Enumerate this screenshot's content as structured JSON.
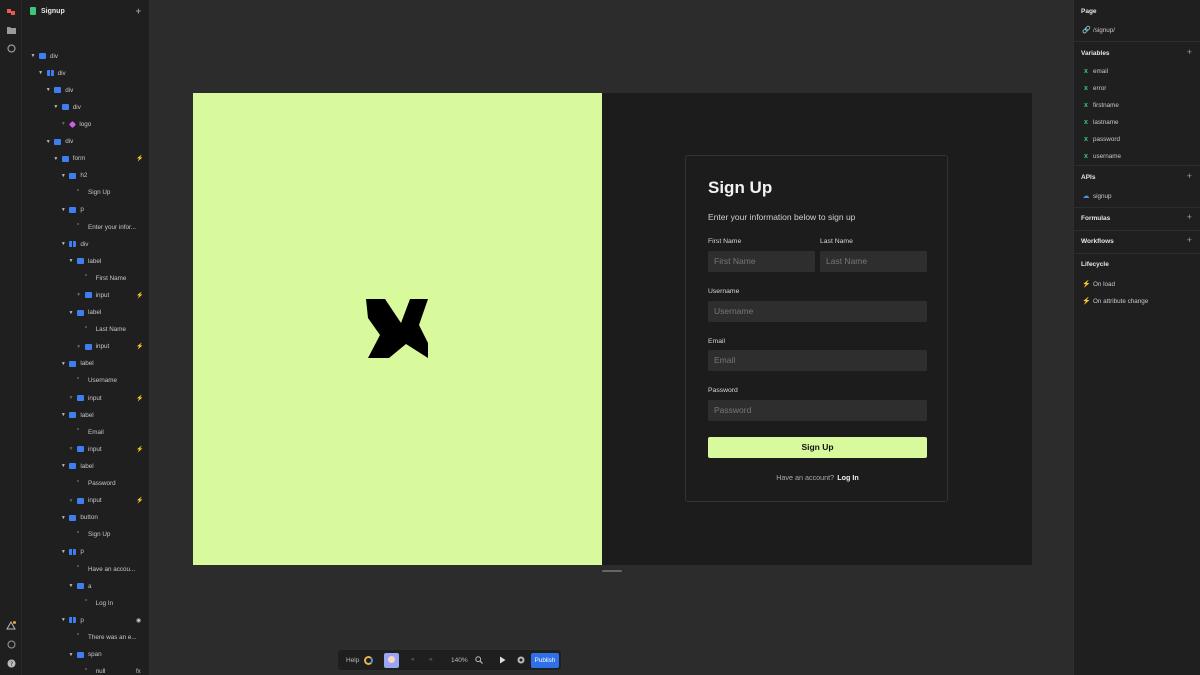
{
  "tree": {
    "title": "Signup",
    "nodes": [
      {
        "label": "div",
        "indent": 0,
        "icon": "block",
        "caret": true
      },
      {
        "label": "div",
        "indent": 1,
        "icon": "col",
        "caret": true
      },
      {
        "label": "div",
        "indent": 2,
        "icon": "block",
        "caret": true
      },
      {
        "label": "div",
        "indent": 3,
        "icon": "block",
        "caret": true
      },
      {
        "label": "logo",
        "indent": 4,
        "icon": "cmp",
        "caret": "dim"
      },
      {
        "label": "div",
        "indent": 2,
        "icon": "block",
        "caret": true
      },
      {
        "label": "form",
        "indent": 3,
        "icon": "block",
        "caret": true,
        "bolt": true
      },
      {
        "label": "h2",
        "indent": 4,
        "icon": "block",
        "caret": true
      },
      {
        "label": "Sign Up",
        "indent": 5,
        "icon": "quote"
      },
      {
        "label": "p",
        "indent": 4,
        "icon": "block",
        "caret": true
      },
      {
        "label": "Enter your infor...",
        "indent": 5,
        "icon": "quote"
      },
      {
        "label": "div",
        "indent": 4,
        "icon": "col",
        "caret": true
      },
      {
        "label": "label",
        "indent": 5,
        "icon": "block",
        "caret": true
      },
      {
        "label": "First Name",
        "indent": 6,
        "icon": "quote"
      },
      {
        "label": "input",
        "indent": 6,
        "icon": "block",
        "caret": "dim",
        "bolt": true
      },
      {
        "label": "label",
        "indent": 5,
        "icon": "block",
        "caret": true
      },
      {
        "label": "Last Name",
        "indent": 6,
        "icon": "quote"
      },
      {
        "label": "input",
        "indent": 6,
        "icon": "block",
        "caret": "dim",
        "bolt": true
      },
      {
        "label": "label",
        "indent": 4,
        "icon": "block",
        "caret": true
      },
      {
        "label": "Username",
        "indent": 5,
        "icon": "quote"
      },
      {
        "label": "input",
        "indent": 5,
        "icon": "block",
        "caret": "dim",
        "bolt": true
      },
      {
        "label": "label",
        "indent": 4,
        "icon": "block",
        "caret": true
      },
      {
        "label": "Email",
        "indent": 5,
        "icon": "quote"
      },
      {
        "label": "input",
        "indent": 5,
        "icon": "block",
        "caret": "dim",
        "bolt": true
      },
      {
        "label": "label",
        "indent": 4,
        "icon": "block",
        "caret": true
      },
      {
        "label": "Password",
        "indent": 5,
        "icon": "quote"
      },
      {
        "label": "input",
        "indent": 5,
        "icon": "block",
        "caret": "dim",
        "bolt": true
      },
      {
        "label": "button",
        "indent": 4,
        "icon": "block",
        "caret": true
      },
      {
        "label": "Sign Up",
        "indent": 5,
        "icon": "quote"
      },
      {
        "label": "p",
        "indent": 4,
        "icon": "col",
        "caret": true
      },
      {
        "label": "Have an accou...",
        "indent": 5,
        "icon": "quote"
      },
      {
        "label": "a",
        "indent": 5,
        "icon": "block",
        "caret": true
      },
      {
        "label": "Log In",
        "indent": 6,
        "icon": "quote"
      },
      {
        "label": "p",
        "indent": 4,
        "icon": "col",
        "caret": true,
        "eye": true
      },
      {
        "label": "There was an e...",
        "indent": 5,
        "icon": "quote"
      },
      {
        "label": "span",
        "indent": 5,
        "icon": "block",
        "caret": true
      },
      {
        "label": "null",
        "indent": 6,
        "icon": "quote",
        "fx": true
      }
    ]
  },
  "form": {
    "title": "Sign Up",
    "subtitle": "Enter your information below to sign up",
    "first_name_label": "First Name",
    "first_name_placeholder": "First Name",
    "last_name_label": "Last Name",
    "last_name_placeholder": "Last Name",
    "username_label": "Username",
    "username_placeholder": "Username",
    "email_label": "Email",
    "email_placeholder": "Email",
    "password_label": "Password",
    "password_placeholder": "Password",
    "submit_label": "Sign Up",
    "have_account": "Have an account?",
    "login_link": "Log In"
  },
  "toolbar": {
    "help": "Help",
    "zoom": "140%",
    "publish": "Publish"
  },
  "right": {
    "page_title": "Page",
    "page_path": "/signup/",
    "variables_title": "Variables",
    "variables": [
      "email",
      "error",
      "firstname",
      "lastname",
      "password",
      "username"
    ],
    "apis_title": "APIs",
    "apis": [
      "signup"
    ],
    "formulas_title": "Formulas",
    "workflows_title": "Workflows",
    "lifecycle_title": "Lifecycle",
    "lifecycle": [
      "On load",
      "On attribute change"
    ]
  },
  "colors": {
    "accent_green": "#d9f99d",
    "publish_blue": "#2f6fe8",
    "canvas_bg": "#1c1c1c"
  }
}
